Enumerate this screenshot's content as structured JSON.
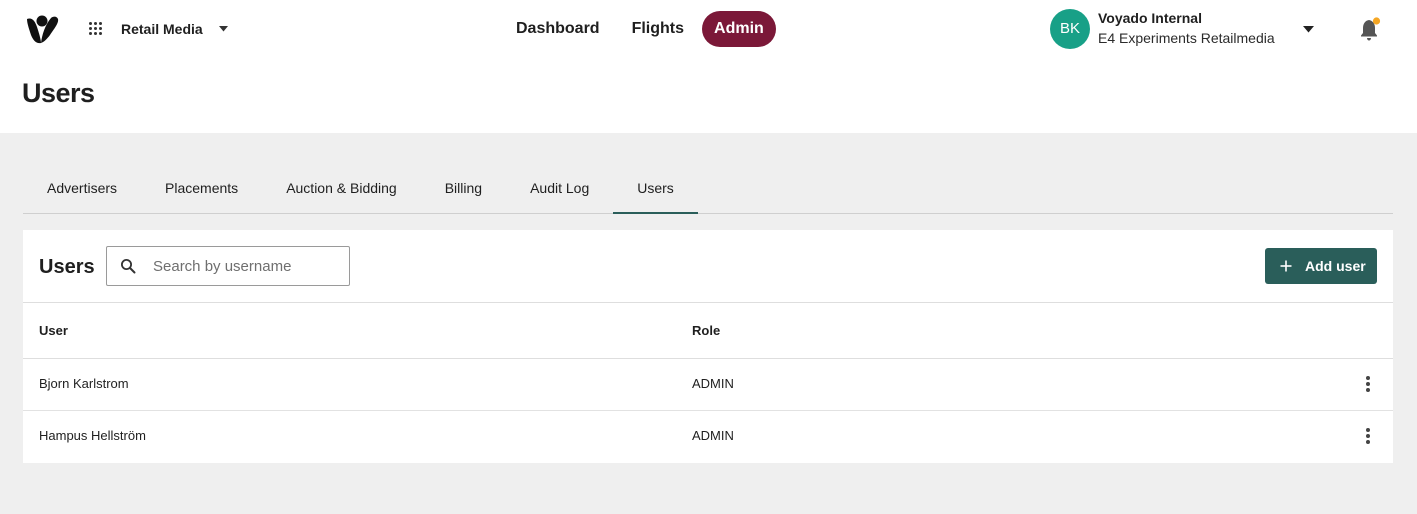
{
  "header": {
    "product_switcher": {
      "label": "Retail Media",
      "icon": "apps-grid-icon"
    },
    "nav": [
      {
        "label": "Dashboard",
        "active": false
      },
      {
        "label": "Flights",
        "active": false
      },
      {
        "label": "Admin",
        "active": true
      }
    ],
    "account": {
      "initials": "BK",
      "name": "Voyado Internal",
      "organization": "E4 Experiments Retailmedia"
    },
    "notification_icon": "bell-icon"
  },
  "page": {
    "title": "Users"
  },
  "tabs": [
    {
      "label": "Advertisers",
      "active": false
    },
    {
      "label": "Placements",
      "active": false
    },
    {
      "label": "Auction & Bidding",
      "active": false
    },
    {
      "label": "Billing",
      "active": false
    },
    {
      "label": "Audit Log",
      "active": false
    },
    {
      "label": "Users",
      "active": true
    }
  ],
  "users_card": {
    "title": "Users",
    "search": {
      "placeholder": "Search by username",
      "value": ""
    },
    "add_button": "Add user",
    "columns": {
      "user": "User",
      "role": "Role"
    },
    "rows": [
      {
        "user": "Bjorn Karlstrom",
        "role": "ADMIN"
      },
      {
        "user": "Hampus Hellström",
        "role": "ADMIN"
      }
    ]
  },
  "colors": {
    "admin_active": "#7b1838",
    "primary_button": "#2a5e5a",
    "avatar": "#18a087",
    "notification_dot": "#f5a623"
  }
}
